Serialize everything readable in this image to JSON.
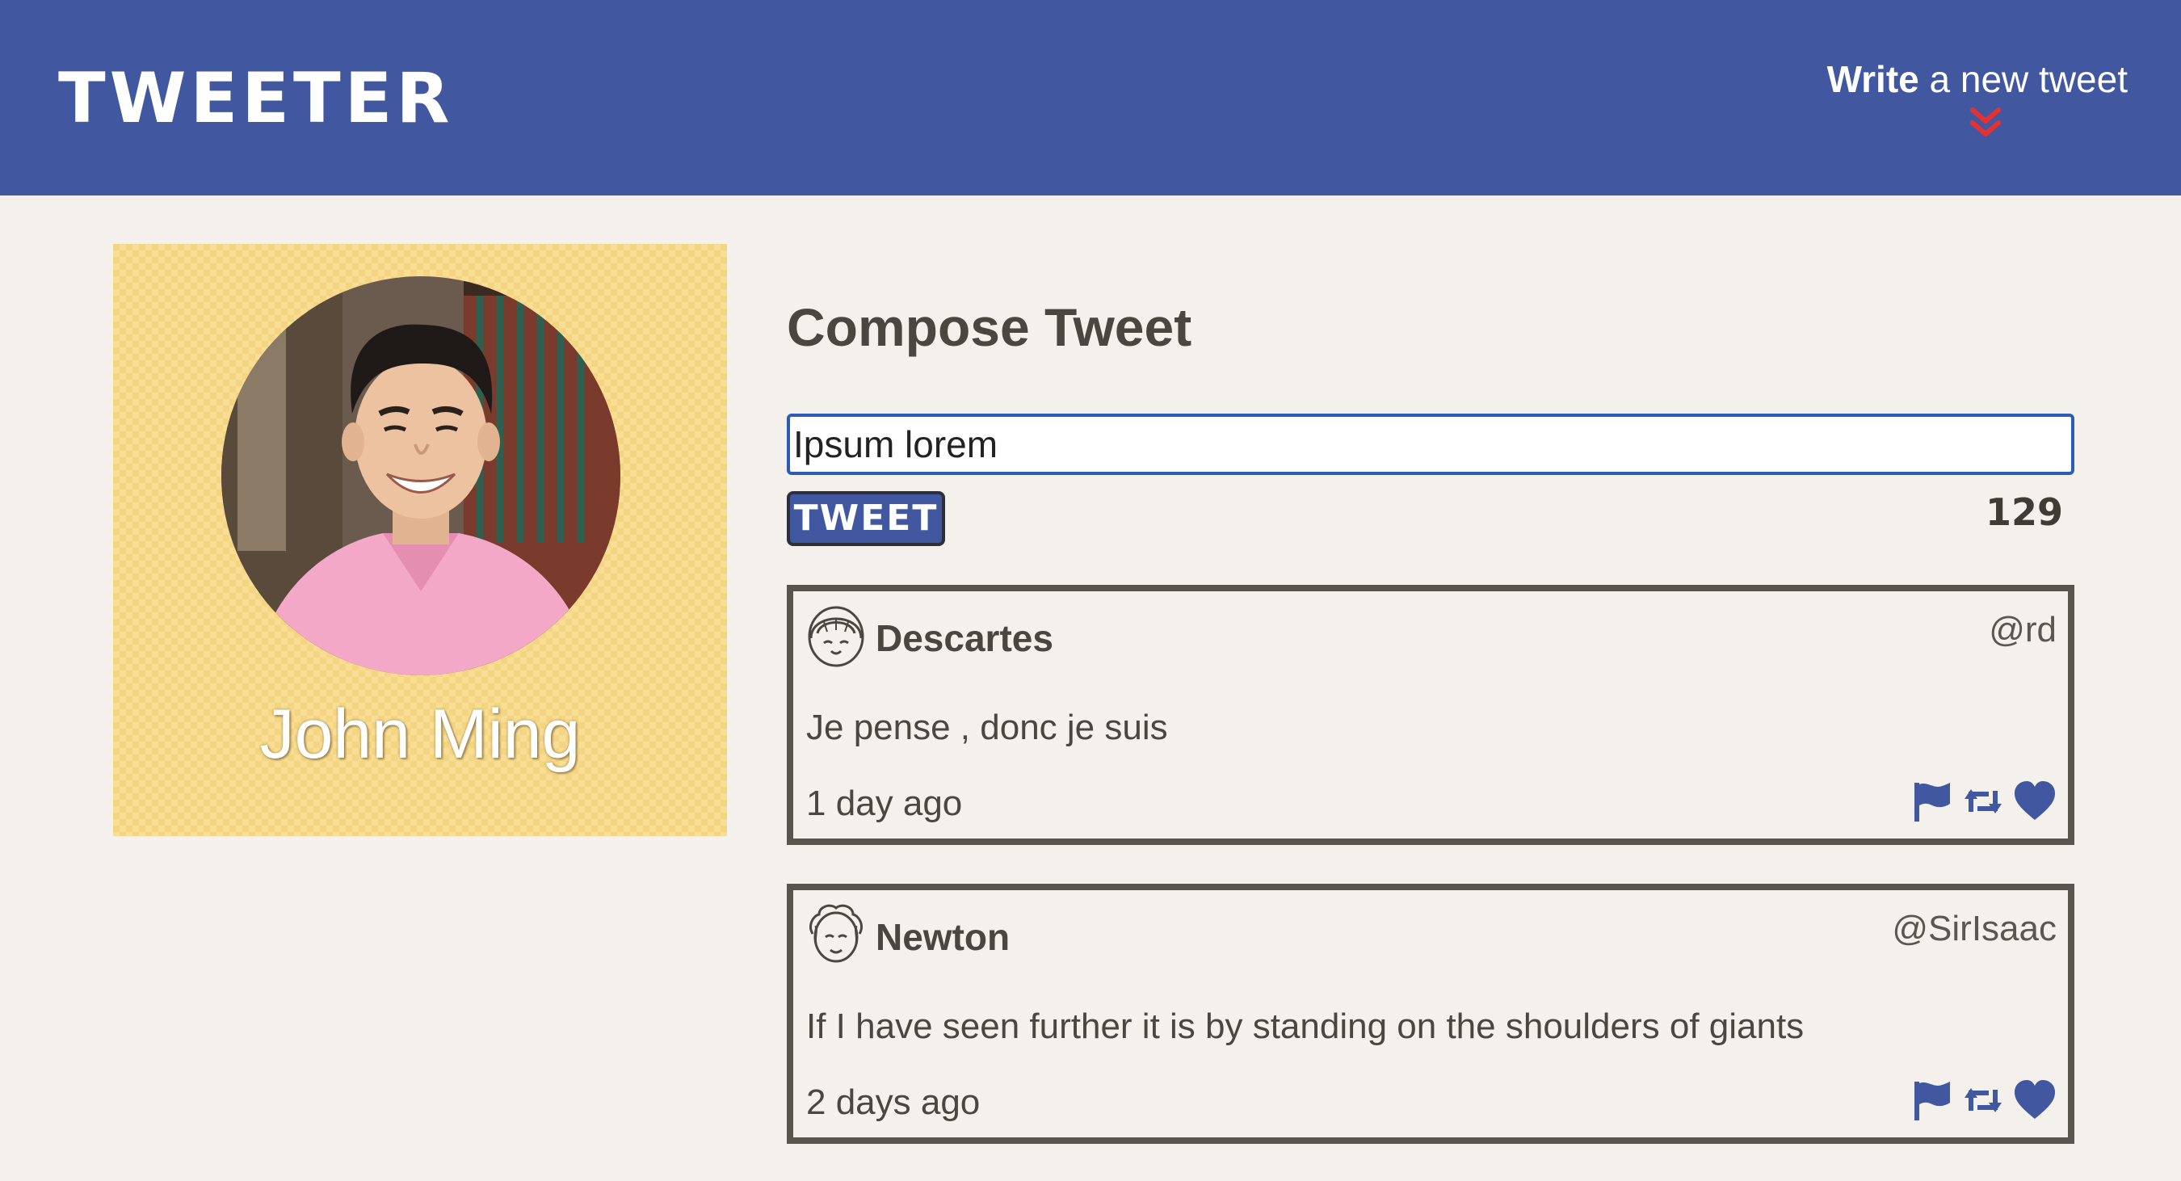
{
  "header": {
    "brand": "TWEETER",
    "write_bold": "Write",
    "write_rest": " a new tweet",
    "chevron_icon": "double-chevron-down-icon",
    "accent_color": "#e8312f"
  },
  "profile": {
    "name": "John Ming",
    "background_color": "#f5d57f"
  },
  "compose": {
    "title": "Compose Tweet",
    "input_value": "Ipsum lorem",
    "button_label": "TWEET",
    "counter": "129"
  },
  "tweets": [
    {
      "author": "Descartes",
      "handle": "@rd",
      "text": "Je pense , donc je suis",
      "time": "1 day ago",
      "avatar_icon": "girl-face-icon"
    },
    {
      "author": "Newton",
      "handle": "@SirIsaac",
      "text": "If I have seen further it is by standing on the shoulders of giants",
      "time": "2 days ago",
      "avatar_icon": "curly-hair-face-icon"
    }
  ],
  "action_icons": [
    "flag-icon",
    "retweet-icon",
    "heart-icon"
  ]
}
